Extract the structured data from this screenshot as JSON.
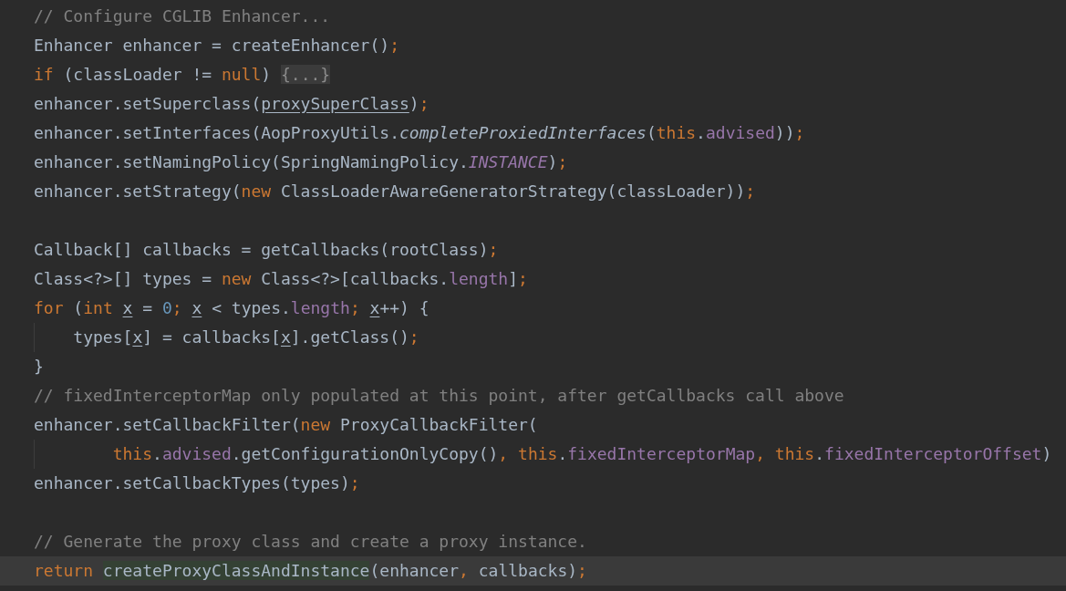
{
  "editor": {
    "lines": [
      {
        "current": false,
        "tokens": [
          {
            "text": "// Configure CGLIB Enhancer...",
            "kind": "comment"
          }
        ]
      },
      {
        "current": false,
        "tokens": [
          {
            "text": "Enhancer enhancer = createEnhancer()",
            "kind": "plain"
          },
          {
            "text": ";",
            "kind": "keyword"
          }
        ]
      },
      {
        "current": false,
        "tokens": [
          {
            "text": "if",
            "kind": "keyword"
          },
          {
            "text": " (classLoader != ",
            "kind": "plain"
          },
          {
            "text": "null",
            "kind": "keyword"
          },
          {
            "text": ") ",
            "kind": "plain"
          },
          {
            "text": "{...}",
            "kind": "folded"
          }
        ]
      },
      {
        "current": false,
        "tokens": [
          {
            "text": "enhancer.setSuperclass(",
            "kind": "plain"
          },
          {
            "text": "proxySuperClass",
            "kind": "reassigned"
          },
          {
            "text": ")",
            "kind": "plain"
          },
          {
            "text": ";",
            "kind": "keyword"
          }
        ]
      },
      {
        "current": false,
        "tokens": [
          {
            "text": "enhancer.setInterfaces(AopProxyUtils.",
            "kind": "plain"
          },
          {
            "text": "completeProxiedInterfaces",
            "kind": "static_method"
          },
          {
            "text": "(",
            "kind": "plain"
          },
          {
            "text": "this",
            "kind": "keyword"
          },
          {
            "text": ".",
            "kind": "plain"
          },
          {
            "text": "advised",
            "kind": "field"
          },
          {
            "text": "))",
            "kind": "plain"
          },
          {
            "text": ";",
            "kind": "keyword"
          }
        ]
      },
      {
        "current": false,
        "tokens": [
          {
            "text": "enhancer.setNamingPolicy(SpringNamingPolicy.",
            "kind": "plain"
          },
          {
            "text": "INSTANCE",
            "kind": "static_field"
          },
          {
            "text": ")",
            "kind": "plain"
          },
          {
            "text": ";",
            "kind": "keyword"
          }
        ]
      },
      {
        "current": false,
        "tokens": [
          {
            "text": "enhancer.setStrategy(",
            "kind": "plain"
          },
          {
            "text": "new",
            "kind": "keyword"
          },
          {
            "text": " ClassLoaderAwareGeneratorStrategy(classLoader))",
            "kind": "plain"
          },
          {
            "text": ";",
            "kind": "keyword"
          }
        ]
      },
      {
        "current": false
      },
      {
        "current": false,
        "tokens": [
          {
            "text": "Callback[] callbacks = getCallbacks(rootClass)",
            "kind": "plain"
          },
          {
            "text": ";",
            "kind": "keyword"
          }
        ]
      },
      {
        "current": false,
        "tokens": [
          {
            "text": "Class<?>[] types = ",
            "kind": "plain"
          },
          {
            "text": "new",
            "kind": "keyword"
          },
          {
            "text": " Class<?>[callbacks.",
            "kind": "plain"
          },
          {
            "text": "length",
            "kind": "field"
          },
          {
            "text": "]",
            "kind": "plain"
          },
          {
            "text": ";",
            "kind": "keyword"
          }
        ]
      },
      {
        "current": false,
        "tokens": [
          {
            "text": "for",
            "kind": "keyword"
          },
          {
            "text": " (",
            "kind": "plain"
          },
          {
            "text": "int ",
            "kind": "keyword"
          },
          {
            "text": "x",
            "kind": "reassigned"
          },
          {
            "text": " = ",
            "kind": "plain"
          },
          {
            "text": "0",
            "kind": "number"
          },
          {
            "text": "; ",
            "kind": "keyword"
          },
          {
            "text": "x",
            "kind": "reassigned"
          },
          {
            "text": " < types.",
            "kind": "plain"
          },
          {
            "text": "length",
            "kind": "field"
          },
          {
            "text": "; ",
            "kind": "keyword"
          },
          {
            "text": "x",
            "kind": "reassigned"
          },
          {
            "text": "++) {",
            "kind": "plain"
          }
        ]
      },
      {
        "current": false,
        "indent_guide": true,
        "tokens": [
          {
            "text": "    types[",
            "kind": "plain"
          },
          {
            "text": "x",
            "kind": "reassigned"
          },
          {
            "text": "] = callbacks[",
            "kind": "plain"
          },
          {
            "text": "x",
            "kind": "reassigned"
          },
          {
            "text": "].getClass()",
            "kind": "plain"
          },
          {
            "text": ";",
            "kind": "keyword"
          }
        ]
      },
      {
        "current": false,
        "tokens": [
          {
            "text": "}",
            "kind": "plain"
          }
        ]
      },
      {
        "current": false,
        "tokens": [
          {
            "text": "// fixedInterceptorMap only populated at this point, after getCallbacks call above",
            "kind": "comment"
          }
        ]
      },
      {
        "current": false,
        "tokens": [
          {
            "text": "enhancer.setCallbackFilter(",
            "kind": "plain"
          },
          {
            "text": "new",
            "kind": "keyword"
          },
          {
            "text": " ProxyCallbackFilter(",
            "kind": "plain"
          }
        ]
      },
      {
        "current": false,
        "indent_guide": true,
        "tokens": [
          {
            "text": "        this",
            "kind": "keyword"
          },
          {
            "text": ".",
            "kind": "plain"
          },
          {
            "text": "advised",
            "kind": "field"
          },
          {
            "text": ".getConfigurationOnlyCopy()",
            "kind": "plain"
          },
          {
            "text": ", ",
            "kind": "keyword"
          },
          {
            "text": "this",
            "kind": "keyword"
          },
          {
            "text": ".",
            "kind": "plain"
          },
          {
            "text": "fixedInterceptorMap",
            "kind": "field"
          },
          {
            "text": ", ",
            "kind": "keyword"
          },
          {
            "text": "this",
            "kind": "keyword"
          },
          {
            "text": ".",
            "kind": "plain"
          },
          {
            "text": "fixedInterceptorOffset",
            "kind": "field"
          },
          {
            "text": ")",
            "kind": "plain"
          }
        ]
      },
      {
        "current": false,
        "tokens": [
          {
            "text": "enhancer.setCallbackTypes(types)",
            "kind": "plain"
          },
          {
            "text": ";",
            "kind": "keyword"
          }
        ]
      },
      {
        "current": false
      },
      {
        "current": false,
        "tokens": [
          {
            "text": "// Generate the proxy class and create a proxy instance.",
            "kind": "comment"
          }
        ]
      },
      {
        "current": true,
        "tokens": [
          {
            "text": "return ",
            "kind": "keyword"
          },
          {
            "text": "createProxyClassAndInstance",
            "kind": "match_highlight"
          },
          {
            "text": "(enhancer",
            "kind": "plain"
          },
          {
            "text": ", ",
            "kind": "keyword"
          },
          {
            "text": "callbacks)",
            "kind": "plain"
          },
          {
            "text": ";",
            "kind": "keyword"
          }
        ]
      }
    ]
  }
}
